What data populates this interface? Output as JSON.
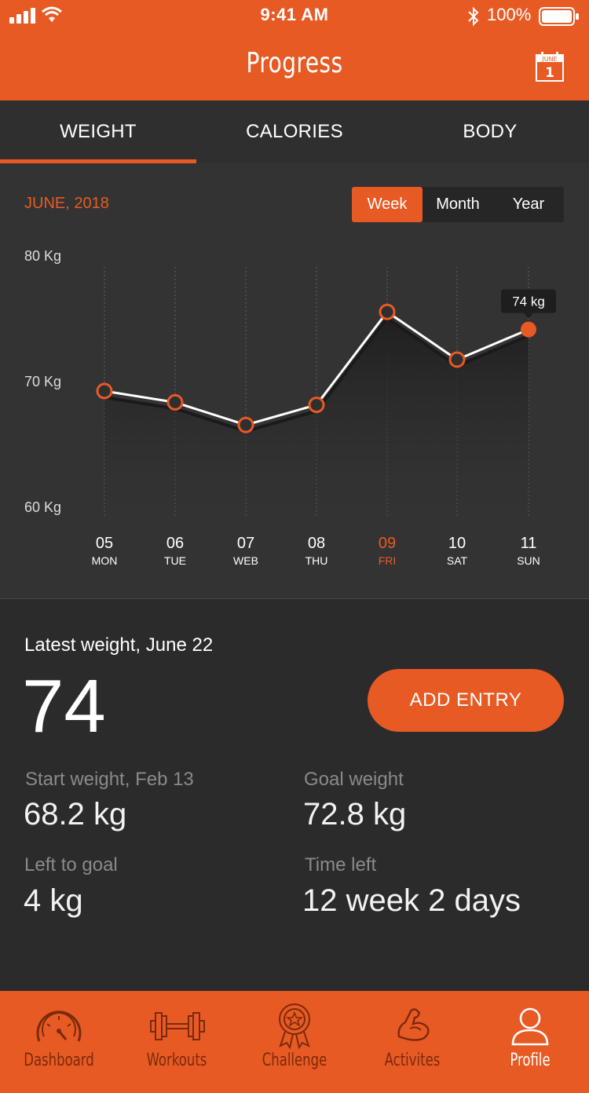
{
  "status_bar": {
    "time": "9:41 AM",
    "battery": "100%"
  },
  "header": {
    "title": "Progress",
    "calendar_month": "JUNE",
    "calendar_day": "1"
  },
  "tabs": [
    {
      "label": "WEIGHT",
      "active": true
    },
    {
      "label": "CALORIES",
      "active": false
    },
    {
      "label": "BODY",
      "active": false
    }
  ],
  "chart_header": {
    "month": "JUNE, 2018",
    "ranges": [
      {
        "label": "Week",
        "active": true
      },
      {
        "label": "Month",
        "active": false
      },
      {
        "label": "Year",
        "active": false
      }
    ]
  },
  "chart_data": {
    "type": "line",
    "title": "",
    "xlabel": "",
    "ylabel": "",
    "ylim": [
      60,
      80
    ],
    "y_ticks": [
      "80 Kg",
      "70 Kg",
      "60 Kg"
    ],
    "y_tick_values": [
      80,
      70,
      60
    ],
    "x_days": [
      "05",
      "06",
      "07",
      "08",
      "09",
      "10",
      "11"
    ],
    "x_weekdays": [
      "MON",
      "TUE",
      "WEB",
      "THU",
      "FRI",
      "SAT",
      "SUN"
    ],
    "values": [
      70.0,
      69.1,
      67.3,
      68.9,
      76.3,
      72.5,
      74.9
    ],
    "highlight_index": 4,
    "tooltip": {
      "label": "74 kg",
      "index": 6
    },
    "grid": "vertical-dotted",
    "line_color": "#ffffff",
    "marker_color": "#e85a24"
  },
  "latest": {
    "label": "Latest weight, June 22",
    "value": "74",
    "add_button": "ADD ENTRY"
  },
  "stats": [
    {
      "label": "Start weight, Feb 13",
      "value": "68.2 kg"
    },
    {
      "label": "Goal weight",
      "value": "72.8 kg"
    },
    {
      "label": "Left to goal",
      "value": "4 kg"
    },
    {
      "label": "Time left",
      "value": "12 week 2 days"
    }
  ],
  "bottom_nav": [
    {
      "label": "Dashboard",
      "icon": "speedometer-icon",
      "active": false
    },
    {
      "label": "Workouts",
      "icon": "dumbbell-icon",
      "active": false
    },
    {
      "label": "Challenge",
      "icon": "medal-icon",
      "active": false
    },
    {
      "label": "Activites",
      "icon": "flexed-arm-icon",
      "active": false
    },
    {
      "label": "Profile",
      "icon": "user-icon",
      "active": true
    }
  ],
  "colors": {
    "accent": "#e85a24",
    "background": "#2b2b2b",
    "chart_bg": "#333333",
    "highlight": "#e85a24"
  }
}
